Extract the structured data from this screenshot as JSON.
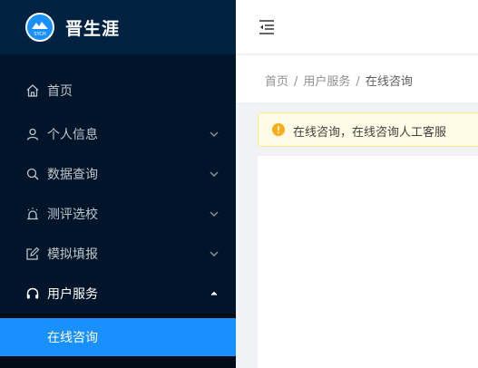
{
  "brand": {
    "title": "晋生涯",
    "logo_text": "SYCH"
  },
  "sidebar": {
    "items": [
      {
        "label": "首页",
        "icon": "home-icon"
      },
      {
        "label": "个人信息",
        "icon": "user-icon",
        "arrow": "chevron-down"
      },
      {
        "label": "数据查询",
        "icon": "search-icon",
        "arrow": "chevron-down"
      },
      {
        "label": "测评选校",
        "icon": "alarm-icon",
        "arrow": "chevron-down"
      },
      {
        "label": "模拟填报",
        "icon": "edit-icon",
        "arrow": "chevron-down"
      },
      {
        "label": "用户服务",
        "icon": "headset-icon",
        "arrow": "chevron-up"
      }
    ],
    "submenu": {
      "active_label": "在线咨询"
    }
  },
  "breadcrumb": {
    "home": "首页",
    "parent": "用户服务",
    "current": "在线咨询",
    "separator": "/"
  },
  "alert": {
    "text": "在线咨询，在线咨询人工客服"
  },
  "colors": {
    "sidebar_bg": "#001529",
    "accent": "#1890ff",
    "alert_bg": "#fffbe6",
    "warning": "#faad14"
  }
}
